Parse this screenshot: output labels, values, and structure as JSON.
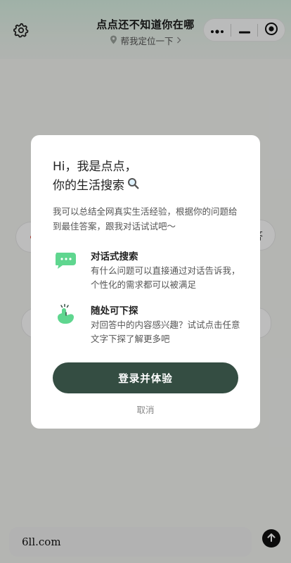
{
  "header": {
    "title": "点点还不知道你在哪",
    "location_prompt": "帮我定位一下",
    "settings_icon": "gear-icon",
    "capsule": {
      "more_icon": "more-dots-icon",
      "minimize_icon": "minimize-icon",
      "close_icon": "target-circle-icon"
    }
  },
  "background": {
    "chip_right_text": "答",
    "input_value": "6ll.com",
    "send_icon": "arrow-up-icon"
  },
  "modal": {
    "greeting_line1": "Hi，我是点点，",
    "greeting_line2": "你的生活搜索",
    "greeting_icon": "magnifier-icon",
    "intro": "我可以总结全网真实生活经验，根据你的问题给到最佳答案，跟我对话试试吧～",
    "features": [
      {
        "icon": "chat-bubble-icon",
        "title": "对话式搜索",
        "description": "有什么问题可以直接通过对话告诉我，个性化的需求都可以被满足"
      },
      {
        "icon": "tap-finger-icon",
        "title": "随处可下探",
        "description": "对回答中的内容感兴趣？试试点击任意文字下探了解更多吧"
      }
    ],
    "login_label": "登录并体验",
    "cancel_label": "取消"
  },
  "colors": {
    "accent_green": "#5fd68f",
    "button_dark_green": "#344d42",
    "overlay": "rgba(0,0,0,0.26)"
  }
}
